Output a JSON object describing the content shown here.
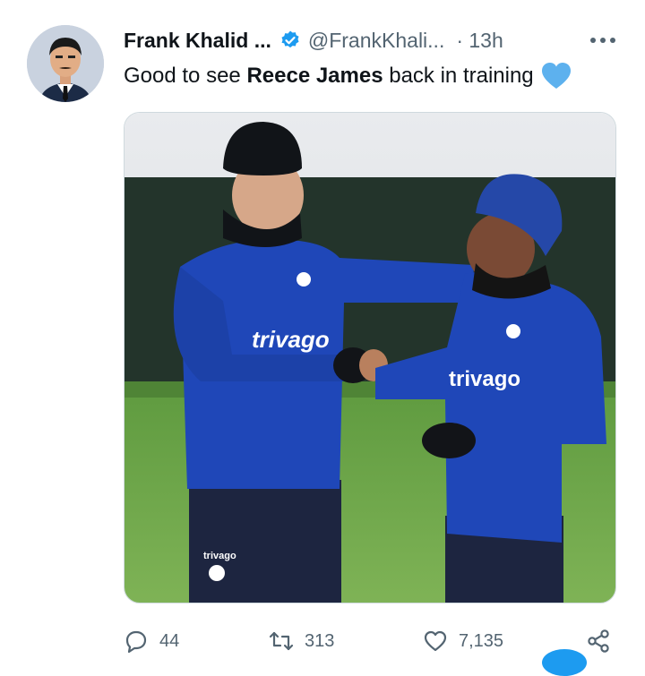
{
  "tweet": {
    "author_name": "Frank Khalid ...",
    "handle": "@FrankKhali...",
    "time": "· 13h",
    "text_before": "Good to see ",
    "text_bold": "Reece James",
    "text_after": " back in training",
    "emoji": "blue-heart"
  },
  "media": {
    "jersey_text_left": "trivago",
    "jersey_text_right": "trivago",
    "shorts_text": "trivago"
  },
  "stats": {
    "replies": "44",
    "retweets": "313",
    "likes": "7,135"
  },
  "icons": {
    "verified": "verified-badge-icon",
    "more": "more-dots-icon",
    "reply": "reply-icon",
    "retweet": "retweet-icon",
    "like": "heart-icon",
    "share": "share-icon"
  },
  "colors": {
    "accent": "#1d9bf0",
    "secondary_text": "#536471",
    "primary_text": "#0f1419",
    "chelsea_blue": "#1f47b8"
  }
}
